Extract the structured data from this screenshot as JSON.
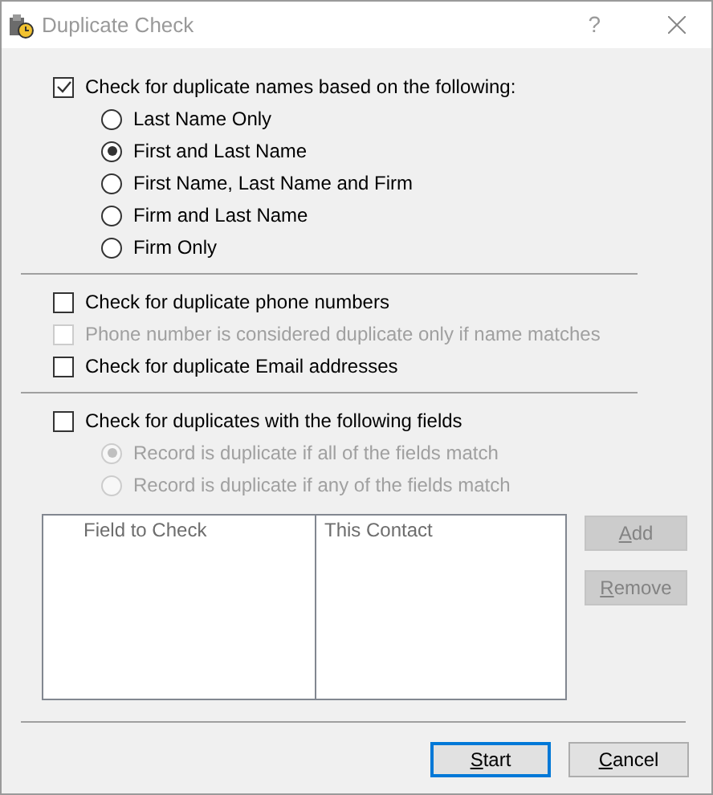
{
  "window": {
    "title": "Duplicate Check",
    "help": "?"
  },
  "names": {
    "label": "Check for duplicate names based on the following:",
    "checked": true,
    "disabled": false,
    "options": [
      {
        "label": "Last Name Only",
        "selected": false
      },
      {
        "label": "First and Last Name",
        "selected": true
      },
      {
        "label": "First Name, Last Name and Firm",
        "selected": false
      },
      {
        "label": "Firm and Last Name",
        "selected": false
      },
      {
        "label": "Firm Only",
        "selected": false
      }
    ]
  },
  "contact_checks": [
    {
      "label": "Check for duplicate phone numbers",
      "checked": false,
      "disabled": false
    },
    {
      "label": "Phone number is considered duplicate only if name matches",
      "checked": false,
      "disabled": true
    },
    {
      "label": "Check for duplicate Email addresses",
      "checked": false,
      "disabled": false
    }
  ],
  "fields": {
    "label": "Check for duplicates with the following fields",
    "checked": false,
    "disabled": false,
    "options": [
      {
        "label": "Record is duplicate if all of the fields match",
        "selected": true,
        "disabled": true
      },
      {
        "label": "Record is duplicate if any of the fields match",
        "selected": false,
        "disabled": true
      }
    ],
    "table": {
      "columns": [
        "Field to Check",
        "This Contact"
      ]
    },
    "buttons": [
      {
        "label": "Add",
        "disabled": true
      },
      {
        "label": "Remove",
        "disabled": true
      }
    ]
  },
  "buttons": [
    {
      "label": "Start",
      "default": true
    },
    {
      "label": "Cancel",
      "default": false
    }
  ]
}
